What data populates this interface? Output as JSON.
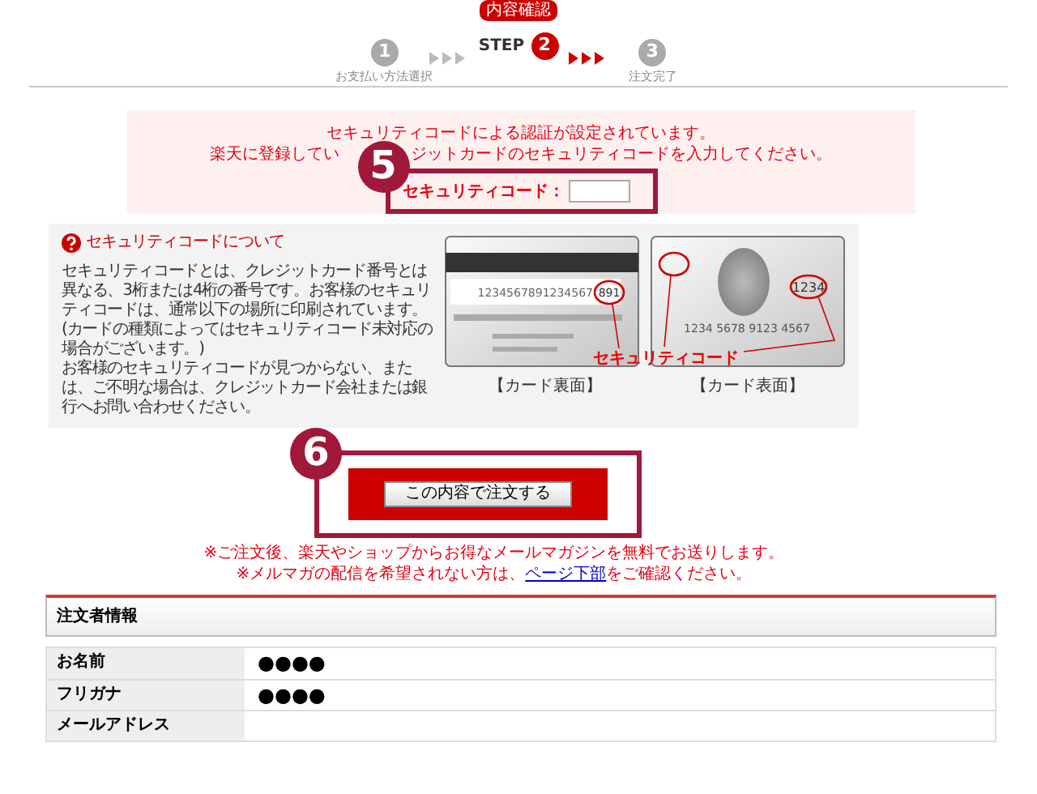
{
  "steps": [
    {
      "number": "1",
      "label": "お支払い方法選択",
      "selected": false
    },
    {
      "number": "2",
      "label": "STEP",
      "tooltip": "内容確認",
      "selected": true
    },
    {
      "number": "3",
      "label": "注文完了",
      "selected": false
    }
  ],
  "security": {
    "line1": "セキュリティコードによる認証が設定されています。",
    "line2_before": "楽天に登録してい",
    "line2_after": "ジットカードのセキュリティコードを入力してください。",
    "callout": "5",
    "field_label": "セキュリティコード："
  },
  "about": {
    "title": "セキュリティコードについて",
    "paragraphs": [
      "セキュリティコードとは、クレジットカード番号とは異なる、3桁または4桁の番号です。お客様のセキュリティコードは、通常以下の場所に印刷されています。(カードの種類によってはセキュリティコード未対応の場合がございます。)",
      "お客様のセキュリティコードが見つからない、または、ご不明な場合は、クレジットカード会社または銀行へお問い合わせください。"
    ],
    "cards": [
      {
        "kind": "back",
        "caption": "【カード裏面】",
        "number": "1234567891234567",
        "code": "891"
      },
      {
        "kind": "front",
        "caption": "【カード表面】",
        "number": "1234 5678 9123 4567",
        "code": "1234"
      }
    ],
    "code_label": "セキュリティコード"
  },
  "order": {
    "callout": "6",
    "button": "この内容で注文する",
    "note1": "※ご注文後、楽天やショップからお得なメールマガジンを無料でお送りします。",
    "note2_before": "※メルマガの配信を希望されない方は、",
    "note2_link": "ページ下部",
    "note2_after": "をご確認ください。"
  },
  "orderer": {
    "title": "注文者情報",
    "rows": [
      {
        "label": "お名前",
        "value": "●●●●"
      },
      {
        "label": "フリガナ",
        "value": "●●●●"
      },
      {
        "label": "メールアドレス"
      }
    ]
  }
}
